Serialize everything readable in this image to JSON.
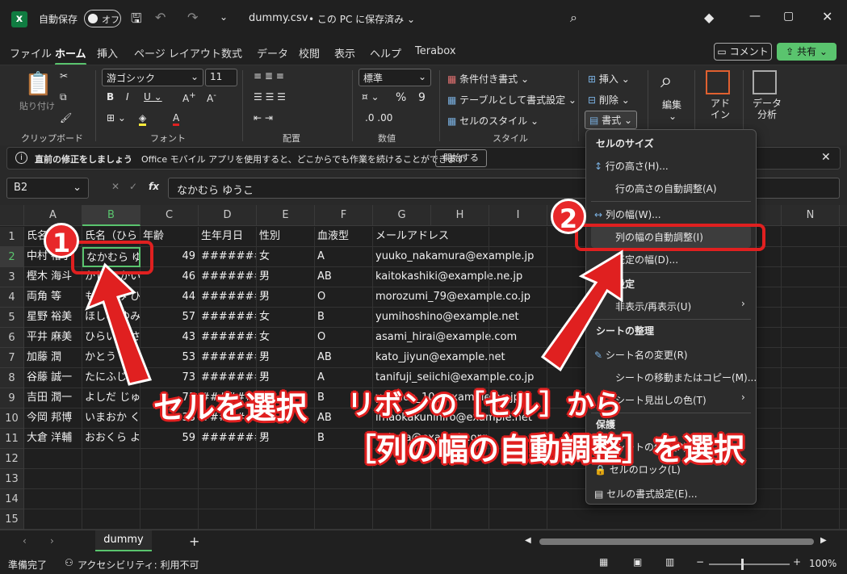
{
  "titlebar": {
    "autosave_label": "自動保存",
    "autosave_state": "オフ",
    "filename": "dummy.csv",
    "save_location": "• この PC に保存済み ⌄"
  },
  "menu": {
    "tabs": [
      "ファイル",
      "ホーム",
      "挿入",
      "ページ レイアウト",
      "数式",
      "データ",
      "校閲",
      "表示",
      "ヘルプ",
      "Terabox"
    ],
    "comment_btn": "コメント",
    "share_btn": "共有"
  },
  "ribbon": {
    "paste": "貼り付け",
    "clipboard": "クリップボード",
    "font_name": "游ゴシック",
    "font_size": "11",
    "font_group": "フォント",
    "align_group": "配置",
    "number_format": "標準",
    "number_group": "数値",
    "cond_format": "条件付き書式 ⌄",
    "table_format": "テーブルとして書式設定 ⌄",
    "cell_style": "セルのスタイル ⌄",
    "style_group": "スタイル",
    "insert": "挿入",
    "delete": "削除",
    "format": "書式",
    "edit": "編集",
    "addin": "アド\nイン",
    "analysis": "データ\n分析"
  },
  "msgbar": {
    "title": "直前の修正をしましょう",
    "text": "Office モバイル アプリを使用すると、どこからでも作業を続けることができます",
    "button": "開始する"
  },
  "formula": {
    "namebox": "B2",
    "fx": "fx",
    "value": "なかむら ゆうこ"
  },
  "columns": [
    "A",
    "B",
    "C",
    "D",
    "E",
    "F",
    "G",
    "H",
    "I",
    "N"
  ],
  "rows": [
    [
      "氏名",
      "氏名（ひら",
      "年齢",
      "生年月日",
      "性別",
      "血液型",
      "メールアドレス"
    ],
    [
      "中村 裕子",
      "なかむら ゆ",
      "49",
      "#######",
      "女",
      "A",
      "yuuko_nakamura@example.jp"
    ],
    [
      "樫木 海斗",
      "かしき かい",
      "46",
      "#######",
      "男",
      "AB",
      "kaitokashiki@example.ne.jp"
    ],
    [
      "両角 等",
      "もろずみ ひ",
      "44",
      "#######",
      "男",
      "O",
      "morozumi_79@example.co.jp"
    ],
    [
      "星野 裕美",
      "ほしの ゆみ",
      "57",
      "#######",
      "女",
      "B",
      "yumihoshino@example.net"
    ],
    [
      "平井 麻美",
      "ひらい あさ",
      "43",
      "#######",
      "女",
      "O",
      "asami_hirai@example.com"
    ],
    [
      "加藤 潤",
      "かとう じ",
      "53",
      "#######",
      "男",
      "AB",
      "kato_jiyun@example.net"
    ],
    [
      "谷藤 誠一",
      "たにふじ せ",
      "73",
      "#######",
      "男",
      "A",
      "tanifuji_seiichi@example.co.jp"
    ],
    [
      "吉田 潤一",
      "よしだ じゅ",
      "71",
      "#######",
      "男",
      "B",
      "yoshida_10@example.ne.jp"
    ],
    [
      "今岡 邦博",
      "いまおか く",
      "33",
      "#######",
      "男",
      "AB",
      "imaokakunihiro@example.net"
    ],
    [
      "大倉 洋輔",
      "おおくら よ",
      "59",
      "#######",
      "男",
      "B",
      "ookura@example.org"
    ]
  ],
  "row_numbers": [
    "1",
    "2",
    "3",
    "4",
    "5",
    "6",
    "7",
    "8",
    "9",
    "10",
    "11",
    "12",
    "13",
    "14",
    "15"
  ],
  "sheet": {
    "name": "dummy"
  },
  "status": {
    "ready": "準備完了",
    "accessibility": "アクセシビリティ: 利用不可",
    "zoom": "100%"
  },
  "format_menu": {
    "h_size": "セルのサイズ",
    "row_height": "行の高さ(H)...",
    "row_auto": "行の高さの自動調整(A)",
    "col_width": "列の幅(W)...",
    "col_auto": "列の幅の自動調整(I)",
    "default_width": "既定の幅(D)...",
    "h_visibility": "表示設定",
    "hide_show": "非表示/再表示(U)",
    "h_organize": "シートの整理",
    "rename": "シート名の変更(R)",
    "move_copy": "シートの移動またはコピー(M)...",
    "tab_color": "シート見出しの色(T)",
    "h_protect": "保護",
    "protect_sheet": "シートの保護(P)...",
    "lock_cell": "セルのロック(L)",
    "format_cells": "セルの書式設定(E)..."
  },
  "annotations": {
    "badge1": "1",
    "badge2": "2",
    "callout1": "セルを選択",
    "callout2a": "リボンの［セル］から",
    "callout2b": "［列の幅の自動調整］を選択"
  },
  "colors": {
    "accent": "#5ac46e",
    "callout": "#e02020"
  }
}
